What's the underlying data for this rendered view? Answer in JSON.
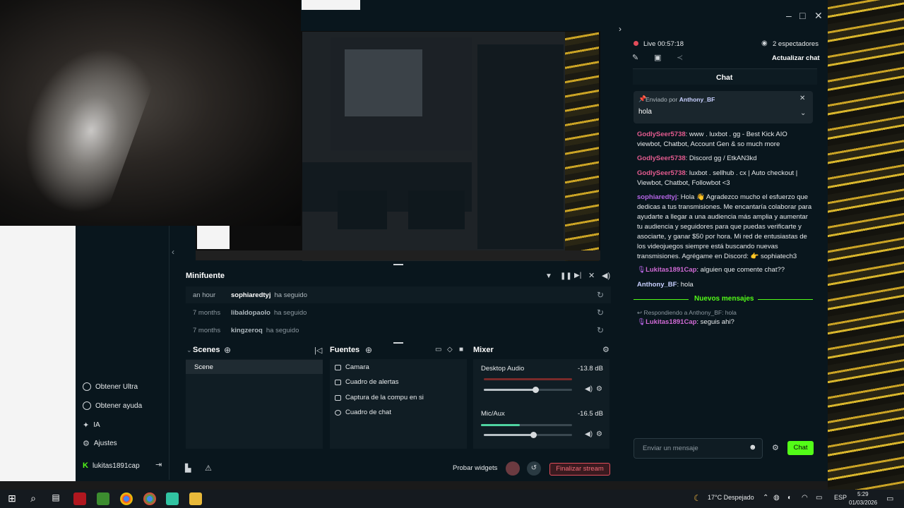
{
  "window": {
    "minimize": "–",
    "maximize": "□",
    "close": "✕"
  },
  "live": {
    "status": "Live 00:57:18",
    "viewers": "2 espectadores",
    "refresh": "Actualizar chat"
  },
  "sidebar": {
    "items": [
      {
        "label": "Obtener Ultra",
        "icon": "ultra-icon"
      },
      {
        "label": "Obtener ayuda",
        "icon": "help-icon"
      },
      {
        "label": "IA",
        "icon": "ai-icon"
      },
      {
        "label": "Ajustes",
        "icon": "settings-icon"
      },
      {
        "label": "lukitas1891cap",
        "icon": "kick-icon"
      }
    ]
  },
  "minifeed": {
    "title": "Minifuente",
    "rows": [
      {
        "time": "an hour",
        "name": "sophiaredtyj",
        "action": "ha seguido"
      },
      {
        "time": "7 months",
        "name": "libaldopaolo",
        "action": "ha seguido"
      },
      {
        "time": "7 months",
        "name": "kingzeroq",
        "action": "ha seguido"
      }
    ]
  },
  "scenes": {
    "title": "Scenes",
    "items": [
      "Scene"
    ]
  },
  "sources": {
    "title": "Fuentes",
    "items": [
      "Camara",
      "Cuadro de alertas",
      "Captura de la compu en si",
      "Cuadro de chat"
    ]
  },
  "mixer": {
    "title": "Mixer",
    "channels": [
      {
        "name": "Desktop Audio",
        "level": "-13.8 dB",
        "volume": 0.58
      },
      {
        "name": "Mic/Aux",
        "level": "-16.5 dB",
        "volume": 0.56
      }
    ]
  },
  "footer": {
    "test_widgets": "Probar widgets",
    "end_stream": "Finalizar stream"
  },
  "chat": {
    "title": "Chat",
    "pinned": {
      "label": "Enviado por",
      "by": "Anthony_BF",
      "text": "hola"
    },
    "messages": [
      {
        "user": "GodlySeer5738",
        "text": ": www . luxbot . gg - Best Kick AIO viewbot, Chatbot, Account Gen & so much more"
      },
      {
        "user": "GodlySeer5738",
        "text": ": Discord gg / EtkAN3kd"
      },
      {
        "user": "GodlySeer5738",
        "text": ": luxbot . sellhub . cx | Auto checkout | Viewbot, Chatbot, Followbot <3"
      },
      {
        "user": "sophiaredtyj",
        "text": ": Hola 👋 Agradezco mucho el esfuerzo que dedicas a tus transmisiones. Me encantaría colaborar para ayudarte a llegar a una audiencia más amplia y aumentar tu audiencia y seguidores para que puedas verificarte y asociarte, y ganar $50 por hora. Mi red de entusiastas de los videojuegos siempre está buscando nuevas transmisiones. Agrégame en Discord: 👉 sophiatech3"
      },
      {
        "user": "Lukitas1891Cap",
        "text": ": alguien que comente chat??"
      },
      {
        "user": "Anthony_BF",
        "text": ": hola"
      }
    ],
    "new_messages": "Nuevos mensajes",
    "reply_to": "Respondiendo a Anthony_BF: hola",
    "reply_msg": {
      "user": "Lukitas1891Cap",
      "text": ": seguis ahi?"
    },
    "input_placeholder": "Enviar un mensaje",
    "send": "Chat"
  },
  "taskbar": {
    "weather": "17°C  Despejado",
    "lang": "ESP",
    "time": "5:29",
    "date": "01/03/2026"
  },
  "colors": {
    "accent_green": "#53fc18",
    "live_red": "#e34c5a",
    "bg": "#09161d"
  }
}
